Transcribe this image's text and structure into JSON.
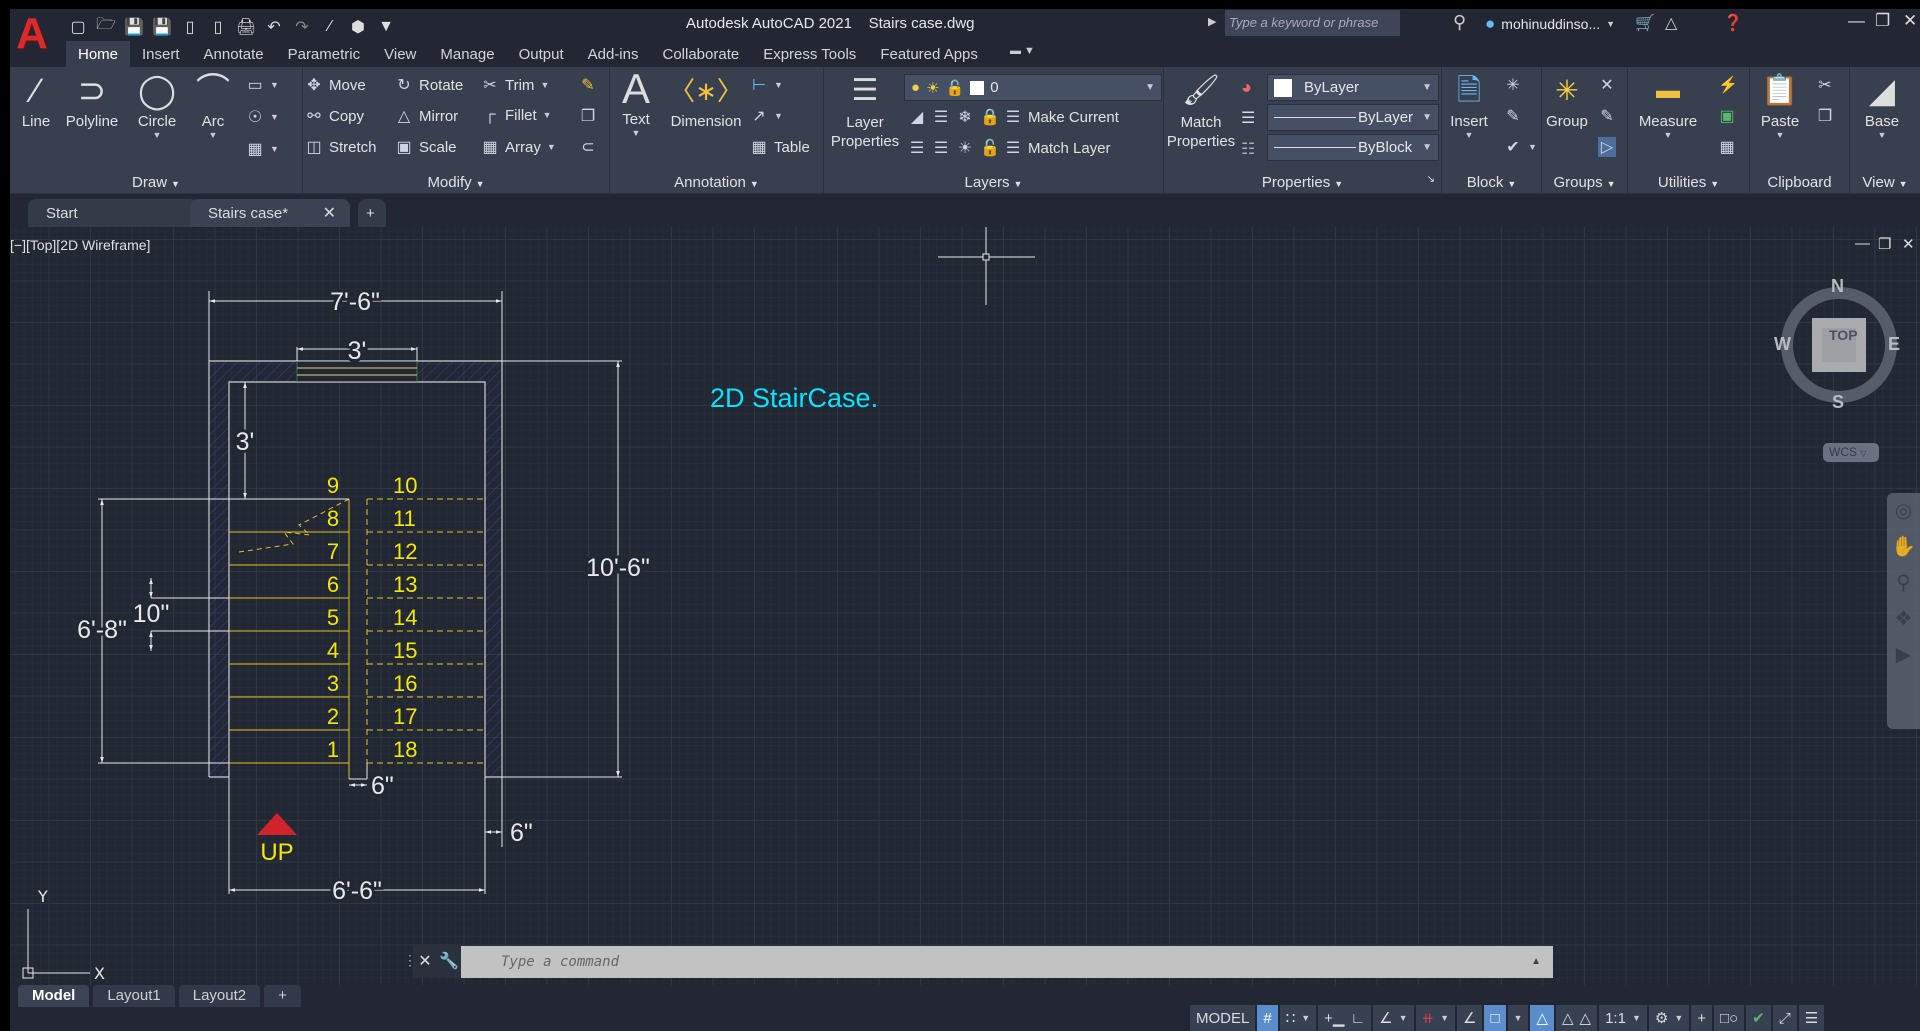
{
  "window": {
    "app_name": "Autodesk AutoCAD 2021",
    "file_name": "Stairs case.dwg",
    "search_placeholder": "Type a keyword or phrase",
    "user_name": "mohinuddinso...",
    "logo_letter": "A"
  },
  "quick_access": [
    "new-icon",
    "open-icon",
    "save-icon",
    "save-as-icon",
    "open-from-web-icon",
    "save-to-web-icon",
    "plot-icon",
    "undo-icon",
    "redo-icon",
    "workspace-line-icon",
    "3d-box-icon",
    "customize-icon"
  ],
  "ribbon_tabs": [
    {
      "label": "Home",
      "active": true
    },
    {
      "label": "Insert"
    },
    {
      "label": "Annotate"
    },
    {
      "label": "Parametric"
    },
    {
      "label": "View"
    },
    {
      "label": "Manage"
    },
    {
      "label": "Output"
    },
    {
      "label": "Add-ins"
    },
    {
      "label": "Collaborate"
    },
    {
      "label": "Express Tools"
    },
    {
      "label": "Featured Apps"
    }
  ],
  "ribbon": {
    "draw": {
      "title": "Draw",
      "line": "Line",
      "polyline": "Polyline",
      "circle": "Circle",
      "arc": "Arc"
    },
    "modify": {
      "title": "Modify",
      "move": "Move",
      "rotate": "Rotate",
      "trim": "Trim",
      "copy": "Copy",
      "mirror": "Mirror",
      "fillet": "Fillet",
      "stretch": "Stretch",
      "scale": "Scale",
      "array": "Array"
    },
    "annotation": {
      "title": "Annotation",
      "text": "Text",
      "dimension": "Dimension",
      "table": "Table"
    },
    "layers": {
      "title": "Layers",
      "layer_properties_1": "Layer",
      "layer_properties_2": "Properties",
      "current_layer": "0",
      "make_current": "Make Current",
      "match_layer": "Match Layer"
    },
    "properties": {
      "title": "Properties",
      "match_1": "Match",
      "match_2": "Properties",
      "color": "ByLayer",
      "linetype": "ByLayer",
      "lineweight": "ByBlock"
    },
    "block": {
      "title": "Block",
      "insert": "Insert"
    },
    "groups": {
      "title": "Groups",
      "group": "Group"
    },
    "utilities": {
      "title": "Utilities",
      "measure": "Measure"
    },
    "clipboard": {
      "title": "Clipboard",
      "paste": "Paste"
    },
    "view": {
      "title": "View",
      "base": "Base"
    }
  },
  "file_tabs": [
    {
      "label": "Start"
    },
    {
      "label": "Stairs case*",
      "active": true
    }
  ],
  "viewport": {
    "label": "[−][Top][2D Wireframe]",
    "title_text": "2D StairCase.",
    "title_color": "#00e5ff",
    "viewcube": {
      "face": "TOP",
      "n": "N",
      "s": "S",
      "e": "E",
      "w": "W",
      "ucs": "WCS"
    },
    "ucs_icon": {
      "x": "X",
      "y": "Y"
    }
  },
  "drawing": {
    "dimensions": {
      "overall_width": "7'-6\"",
      "door_width": "3'",
      "landing_depth": "3'",
      "overall_length": "10'-6\"",
      "flight_length": "6'-8\"",
      "tread": "10\"",
      "gap": "6\"",
      "wall": "6\"",
      "inner_width": "6'-6\""
    },
    "steps_left": [
      "1",
      "2",
      "3",
      "4",
      "5",
      "6",
      "7",
      "8",
      "9"
    ],
    "steps_right": [
      "10",
      "11",
      "12",
      "13",
      "14",
      "15",
      "16",
      "17",
      "18"
    ],
    "up_label": "UP",
    "colors": {
      "dim": "#e8e8e8",
      "tread": "#e8c020",
      "step_text": "#f5e800",
      "hatch": "#3a3fa8",
      "arrow": "#d0232a"
    }
  },
  "command_line": {
    "placeholder": "Type a command"
  },
  "layout_tabs": [
    {
      "label": "Model",
      "active": true
    },
    {
      "label": "Layout1"
    },
    {
      "label": "Layout2"
    }
  ],
  "status_bar": {
    "model": "MODEL",
    "scale": "1:1"
  }
}
